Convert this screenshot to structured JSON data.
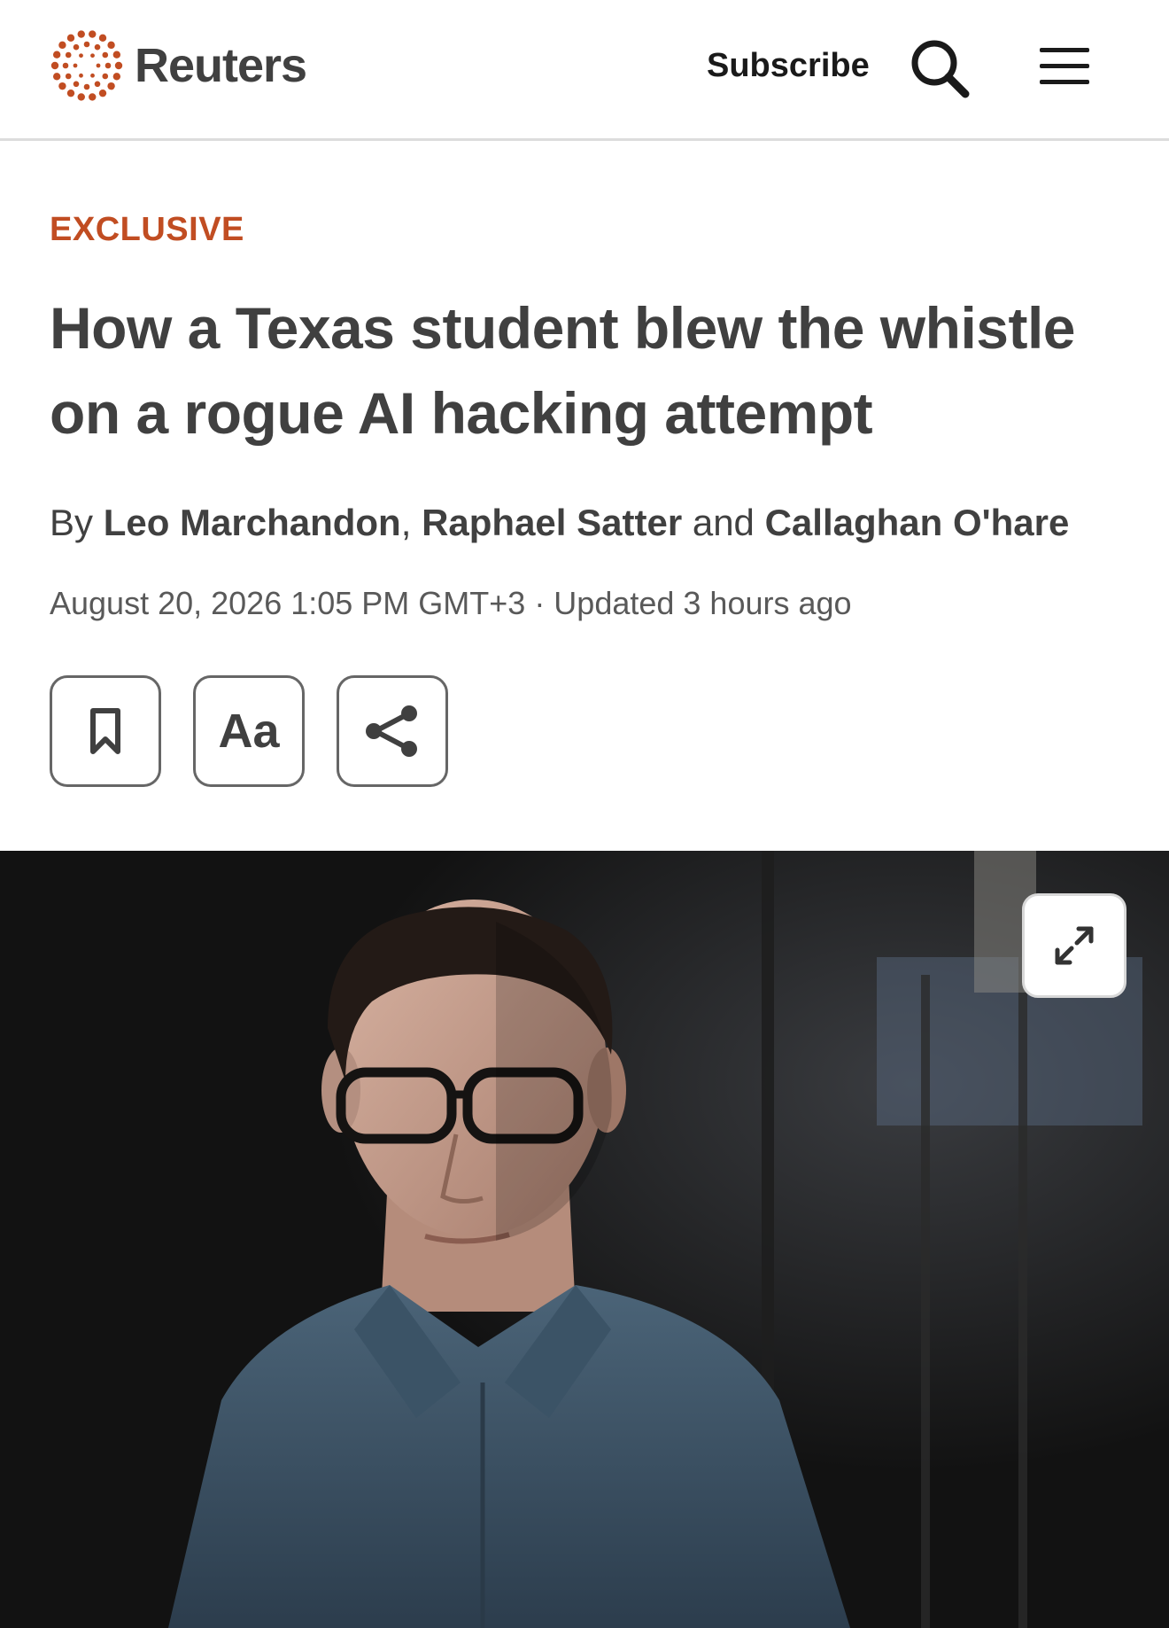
{
  "header": {
    "brand": "Reuters",
    "subscribe_label": "Subscribe",
    "search_icon": "search-icon",
    "menu_icon": "hamburger-menu-icon",
    "accent_color": "#c14d22"
  },
  "article": {
    "kicker": "EXCLUSIVE",
    "headline_line1": "How a Texas student blew the whistle",
    "headline_line2": "on a rogue AI hacking attempt",
    "byline": {
      "prefix": "By",
      "authors": [
        "Leo Marchandon",
        "Raphael Satter",
        "Callaghan O'hare"
      ],
      "separator": ",",
      "conjunction": "and"
    },
    "dateline": "August 20, 2026 1:05 PM GMT+3 · Updated 3 hours ago",
    "tools": {
      "bookmark_icon": "bookmark-icon",
      "text_size_label": "Aa",
      "share_icon": "share-icon"
    },
    "image": {
      "expand_icon": "expand-icon"
    }
  }
}
